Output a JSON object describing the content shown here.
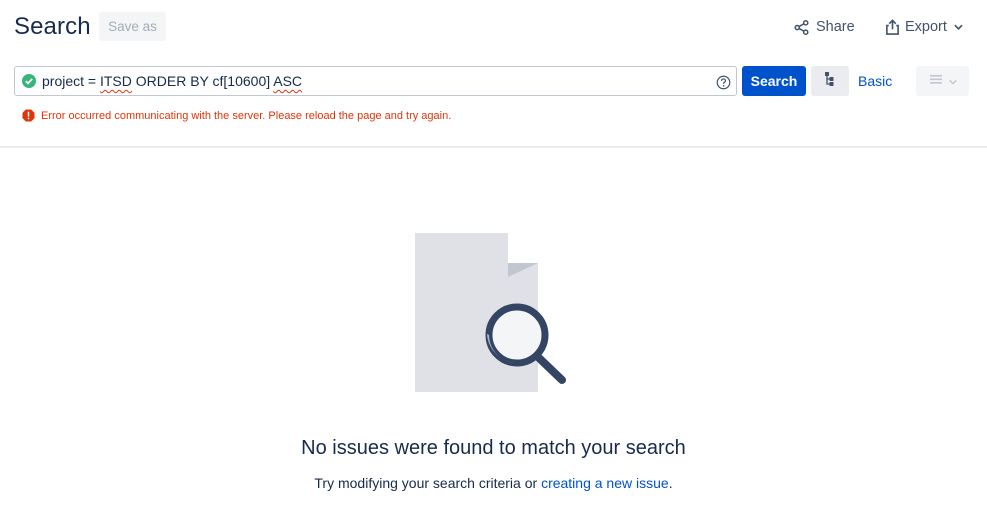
{
  "header": {
    "title": "Search",
    "save_as_label": "Save as",
    "share_label": "Share",
    "export_label": "Export"
  },
  "query": {
    "prefix": "project = ",
    "project_key": "ITSD",
    "middle": " ORDER BY cf[10600] ",
    "direction": "ASC",
    "status": "valid"
  },
  "controls": {
    "search_label": "Search",
    "basic_label": "Basic"
  },
  "error": {
    "message": "Error occurred communicating with the server. Please reload the page and try again."
  },
  "empty_state": {
    "title": "No issues were found to match your search",
    "description_prefix": "Try modifying your search criteria or ",
    "link_label": "creating a new issue",
    "description_suffix": "."
  },
  "colors": {
    "primary": "#0052cc",
    "error": "#de350b",
    "success": "#36b37e",
    "text": "#172b4d"
  },
  "icons": {
    "valid": "check-circle-icon",
    "help": "question-circle-icon",
    "share": "share-icon",
    "export": "export-icon",
    "switch": "query-switch-icon",
    "layout": "list-layout-icon",
    "error": "error-icon"
  }
}
